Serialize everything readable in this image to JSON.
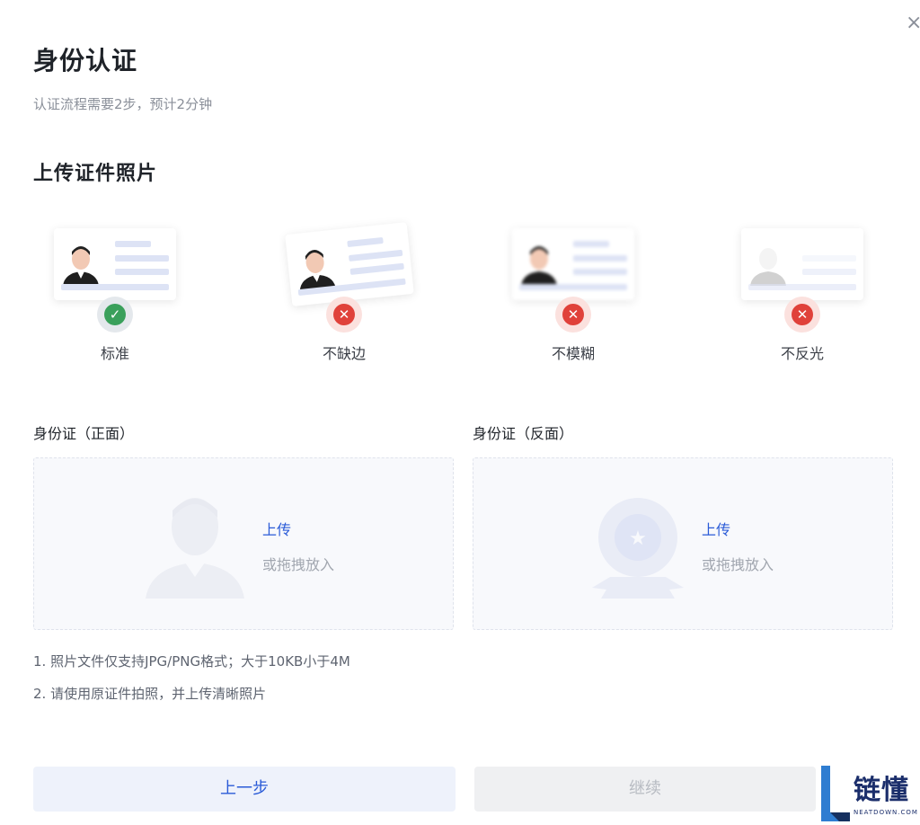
{
  "dialog": {
    "title": "身份认证",
    "subtitle": "认证流程需要2步，预计2分钟",
    "close_glyph": "×"
  },
  "section": {
    "title": "上传证件照片"
  },
  "examples": [
    {
      "label": "标准",
      "status": "ok",
      "status_glyph": "✓"
    },
    {
      "label": "不缺边",
      "status": "bad",
      "status_glyph": "✕"
    },
    {
      "label": "不模糊",
      "status": "bad",
      "status_glyph": "✕"
    },
    {
      "label": "不反光",
      "status": "bad",
      "status_glyph": "✕"
    }
  ],
  "uploads": {
    "front": {
      "label": "身份证（正面）",
      "action": "上传",
      "hint": "或拖拽放入"
    },
    "back": {
      "label": "身份证（反面）",
      "action": "上传",
      "hint": "或拖拽放入",
      "emblem_glyph": "★"
    }
  },
  "notes": [
    "1. 照片文件仅支持JPG/PNG格式；大于10KB小于4M",
    "2. 请使用原证件拍照，并上传清晰照片"
  ],
  "buttons": {
    "prev": "上一步",
    "next": "继续"
  },
  "brand": {
    "cn": "链懂",
    "en": "NEATDOWN.COM"
  },
  "colors": {
    "accent": "#2a5bd7",
    "ok": "#3aa05b",
    "error": "#e0413a",
    "brand": "#1b2e6b"
  },
  "icons": [
    "close-icon",
    "check-icon",
    "cross-icon",
    "person-icon",
    "emblem-icon"
  ]
}
